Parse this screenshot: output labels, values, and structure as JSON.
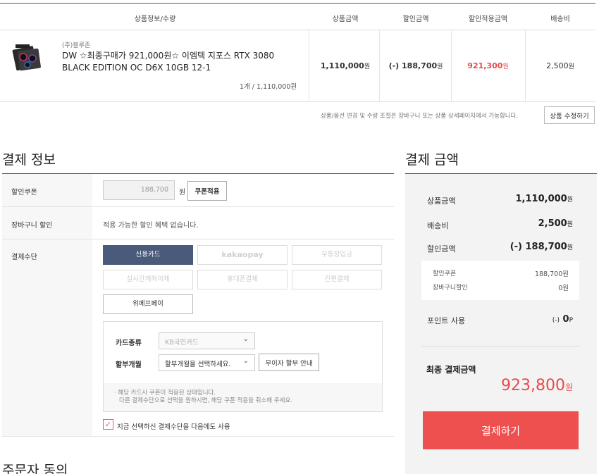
{
  "order_table": {
    "headers": {
      "product_info": "상품정보/수량",
      "price": "상품금액",
      "discount": "할인금액",
      "discounted_price": "할인적용금액",
      "shipping": "배송비"
    },
    "item": {
      "seller": "(주)블루존",
      "name": "DW ☆최종구매가 921,000원☆ 이엠텍 지포스 RTX 3080 BLACK EDITION OC D6X 10GB 12-1",
      "qty_price": "1개 / 1,110,000원",
      "price": "1,110,000",
      "discount": "(-) 188,700",
      "discounted_price": "921,300",
      "shipping": "2,500",
      "won": "원"
    },
    "note": "상품/옵션 변경 및 수량 조절은 장바구니 또는 상품 상세페이지에서 가능합니다.",
    "edit_button": "상품 수정하기"
  },
  "payment_info": {
    "title": "결제 정보",
    "coupon_label": "할인쿠폰",
    "coupon_value": "188,700",
    "coupon_unit": "원",
    "coupon_button": "쿠폰적용",
    "cart_discount_label": "장바구니 할인",
    "cart_discount_text": "적용 가능한 할인 혜택 없습니다.",
    "method_label": "결제수단",
    "methods": {
      "credit_card": "신용카드",
      "kakaopay": "kakaopay",
      "bank_deposit": "무통장입금",
      "realtime_transfer": "실시간계좌이체",
      "mobile": "휴대폰결제",
      "simple": "간편결제",
      "wemakepay": "위메프페이"
    },
    "card_type_label": "카드종류",
    "card_type_value": "KB국민카드",
    "installment_label": "할부개월",
    "installment_value": "할부개월을 선택하세요.",
    "installment_button": "무이자 할부 안내",
    "card_note_1": "· 해당 카드사 쿠폰이 적용된 상태입니다.",
    "card_note_2": "다른 결제수단으로 선택을 원하시면, 해당 쿠폰 적용을 취소해 주세요.",
    "remember_checkbox": "지금 선택하신 결제수단을 다음에도 사용"
  },
  "order_agree": {
    "title": "주문자 동의"
  },
  "summary": {
    "title": "결제 금액",
    "price_label": "상품금액",
    "price_value": "1,110,000",
    "shipping_label": "배송비",
    "shipping_value": "2,500",
    "discount_label": "할인금액",
    "discount_value": "(-) 188,700",
    "coupon_label": "할인쿠폰",
    "coupon_value": "188,700원",
    "cart_discount_label": "장바구니할인",
    "cart_discount_value": "0원",
    "point_label": "포인트 사용",
    "point_prefix": "(-)",
    "point_value": "0",
    "point_unit": "P",
    "won": "원",
    "final_label": "최종 결제금액",
    "final_value": "923,800",
    "pay_button": "결제하기"
  },
  "colors": {
    "accent_red": "#ee5050",
    "active_method": "#4a5a7a"
  }
}
